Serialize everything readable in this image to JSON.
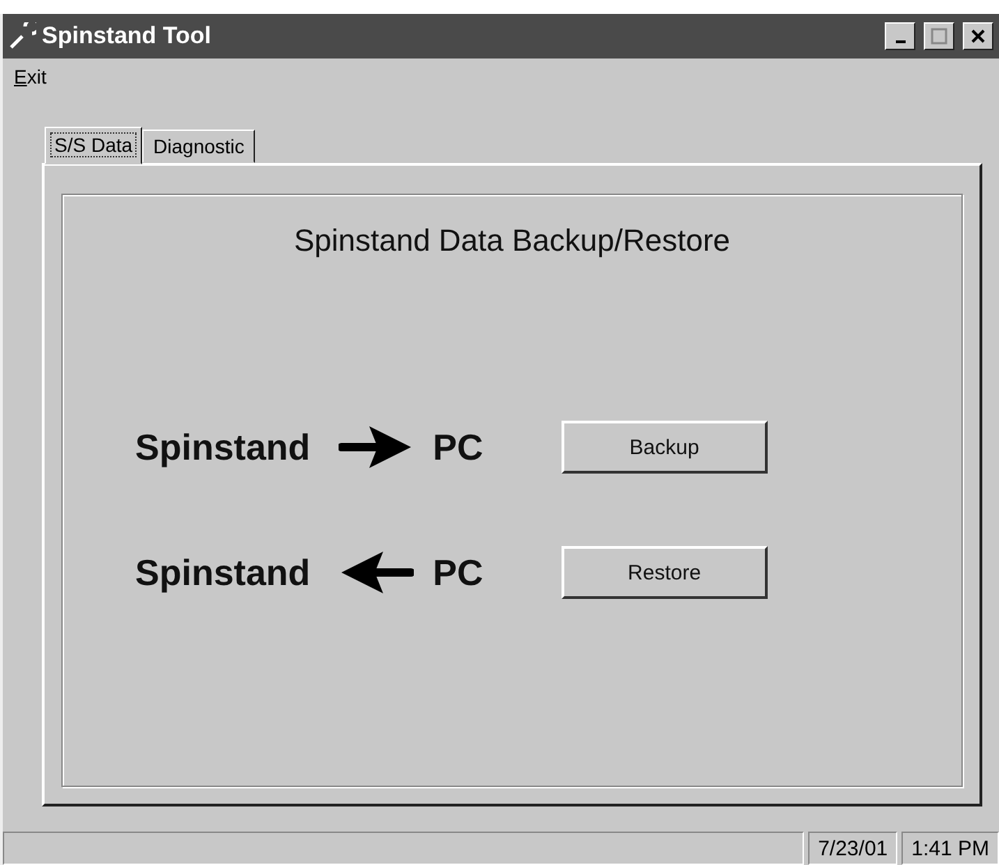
{
  "window": {
    "title": "Spinstand Tool"
  },
  "menu": [
    {
      "label": "Exit"
    }
  ],
  "tabs": [
    {
      "label": "S/S Data",
      "selected": true
    },
    {
      "label": "Diagnostic",
      "selected": false
    }
  ],
  "panel": {
    "heading": "Spinstand Data Backup/Restore",
    "rows": [
      {
        "left": "Spinstand",
        "kind": "right",
        "right": "PC",
        "button": "Backup"
      },
      {
        "left": "Spinstand",
        "kind": "left",
        "right": "PC",
        "button": "Restore"
      }
    ]
  },
  "status_bar": [
    "7/23/01",
    "1:41 PM"
  ]
}
